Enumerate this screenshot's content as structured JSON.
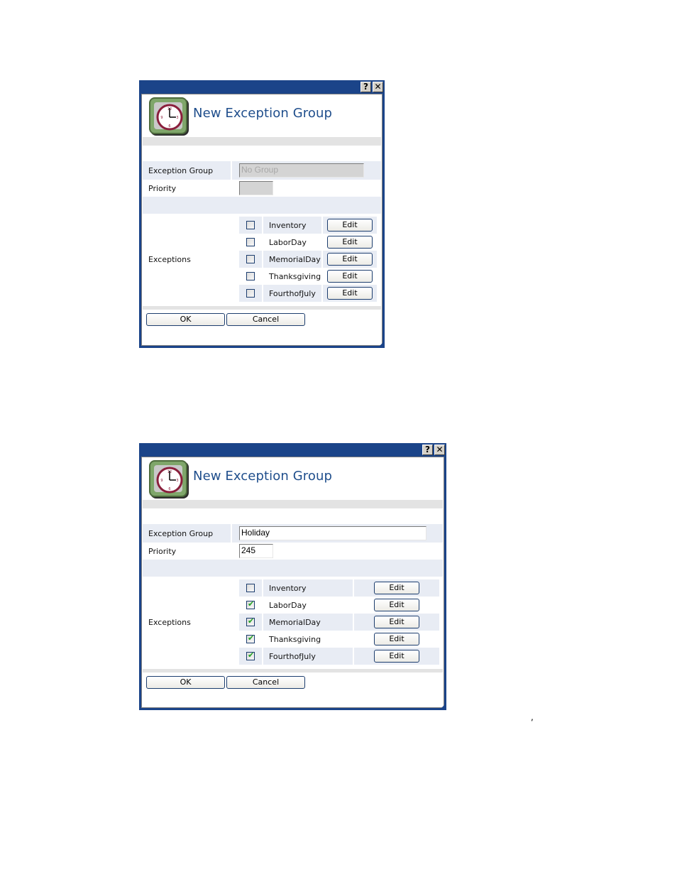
{
  "dialogs": [
    {
      "title_bar": {
        "help_label": "?",
        "close_label": "✕"
      },
      "header": {
        "icon": "clock-icon",
        "title": "New Exception Group"
      },
      "fields": {
        "group_label": "Exception Group",
        "group_value": "No Group",
        "group_disabled": true,
        "priority_label": "Priority",
        "priority_value": "",
        "priority_disabled": true
      },
      "exceptions_label": "Exceptions",
      "exceptions": [
        {
          "name": "Inventory",
          "checked": false,
          "edit_label": "Edit"
        },
        {
          "name": "LaborDay",
          "checked": false,
          "edit_label": "Edit"
        },
        {
          "name": "MemorialDay",
          "checked": false,
          "edit_label": "Edit"
        },
        {
          "name": "Thanksgiving",
          "checked": false,
          "edit_label": "Edit"
        },
        {
          "name": "FourthofJuly",
          "checked": false,
          "edit_label": "Edit"
        }
      ],
      "buttons": {
        "ok": "OK",
        "cancel": "Cancel"
      }
    },
    {
      "title_bar": {
        "help_label": "?",
        "close_label": "✕"
      },
      "header": {
        "icon": "clock-icon",
        "title": "New Exception Group"
      },
      "fields": {
        "group_label": "Exception Group",
        "group_value": "Holiday",
        "group_disabled": false,
        "priority_label": "Priority",
        "priority_value": "245",
        "priority_disabled": false
      },
      "exceptions_label": "Exceptions",
      "exceptions": [
        {
          "name": "Inventory",
          "checked": false,
          "edit_label": "Edit"
        },
        {
          "name": "LaborDay",
          "checked": true,
          "edit_label": "Edit"
        },
        {
          "name": "MemorialDay",
          "checked": true,
          "edit_label": "Edit"
        },
        {
          "name": "Thanksgiving",
          "checked": true,
          "edit_label": "Edit"
        },
        {
          "name": "FourthofJuly",
          "checked": true,
          "edit_label": "Edit"
        }
      ],
      "buttons": {
        "ok": "OK",
        "cancel": "Cancel"
      }
    }
  ],
  "stray_mark": ",",
  "colors": {
    "titlebar": "#1b4489",
    "title_text": "#1f4e8c",
    "checkmark": "#21a121"
  }
}
